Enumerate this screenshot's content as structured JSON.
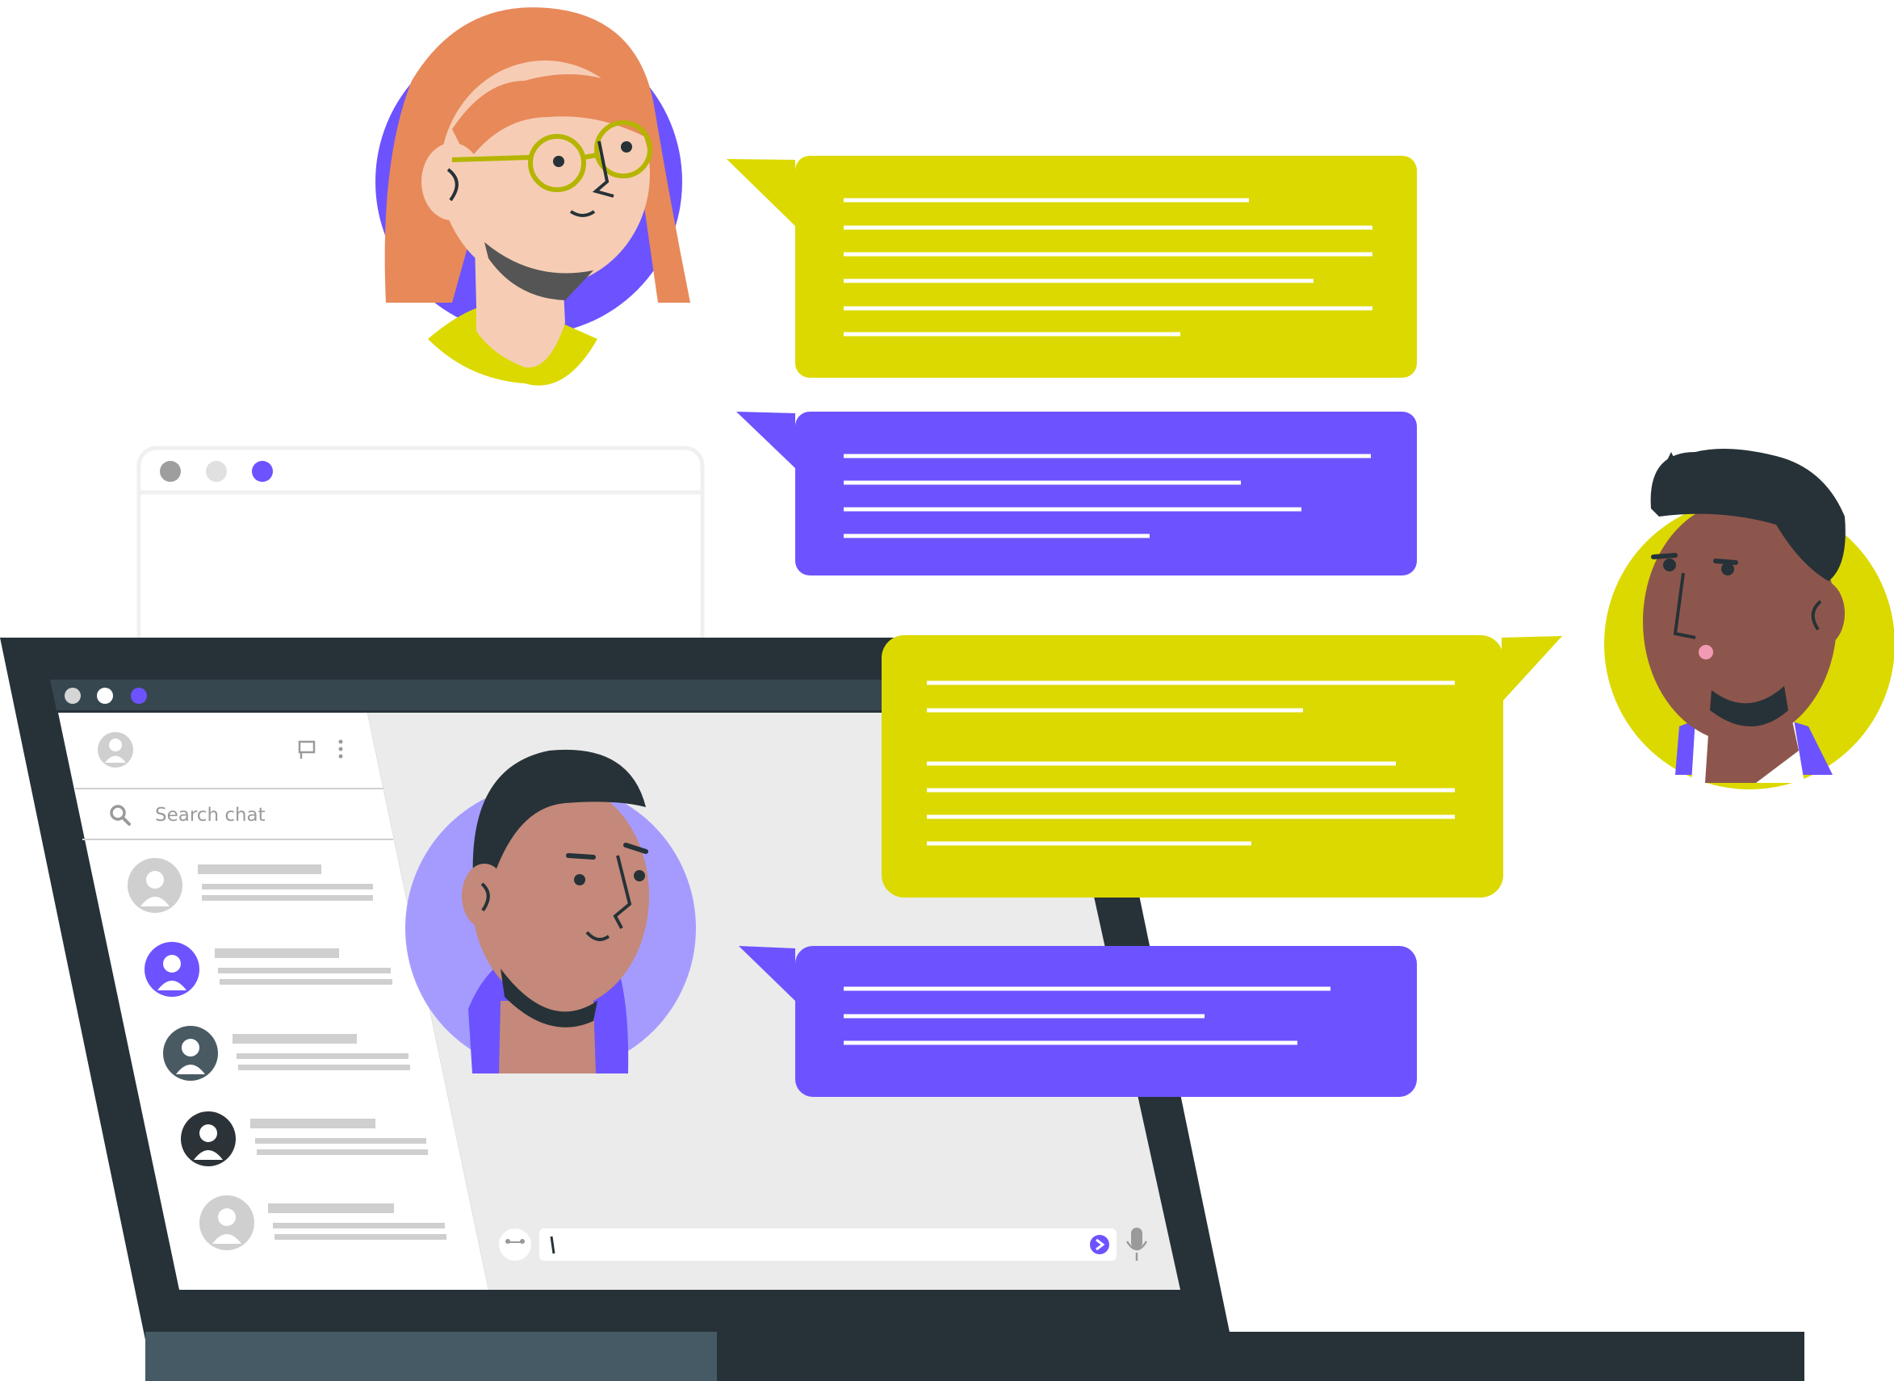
{
  "chat_window": {
    "search": {
      "placeholder": "Search chat"
    },
    "composer": {
      "value": "",
      "send_icon": "send-icon",
      "mic_icon": "microphone-icon",
      "emoji_icon": "emoji-icon"
    },
    "header_icons": [
      "chat-icon",
      "more-vertical-icon"
    ],
    "window_controls_colors": [
      "#d5d5d5",
      "#ffffff",
      "#6c53ff"
    ]
  },
  "contacts": [
    {
      "avatar_color": "#cfcfcf"
    },
    {
      "avatar_color": "#6c53ff"
    },
    {
      "avatar_color": "#4a5a63"
    },
    {
      "avatar_color": "#2b3238"
    },
    {
      "avatar_color": "#cfcfcf"
    }
  ],
  "messages": [
    {
      "from": "woman-with-glasses",
      "color": "#dcd900",
      "line_count": 6
    },
    {
      "from": "woman-with-glasses",
      "color": "#6c53ff",
      "line_count": 4
    },
    {
      "from": "man-right",
      "color": "#dcd900",
      "line_count": 6
    },
    {
      "from": "man-on-screen",
      "color": "#6c53ff",
      "line_count": 3
    }
  ],
  "colors": {
    "accent_purple": "#6c53ff",
    "accent_yellow": "#dcd900",
    "laptop_frame": "#263238",
    "laptop_base": "#455a64"
  }
}
